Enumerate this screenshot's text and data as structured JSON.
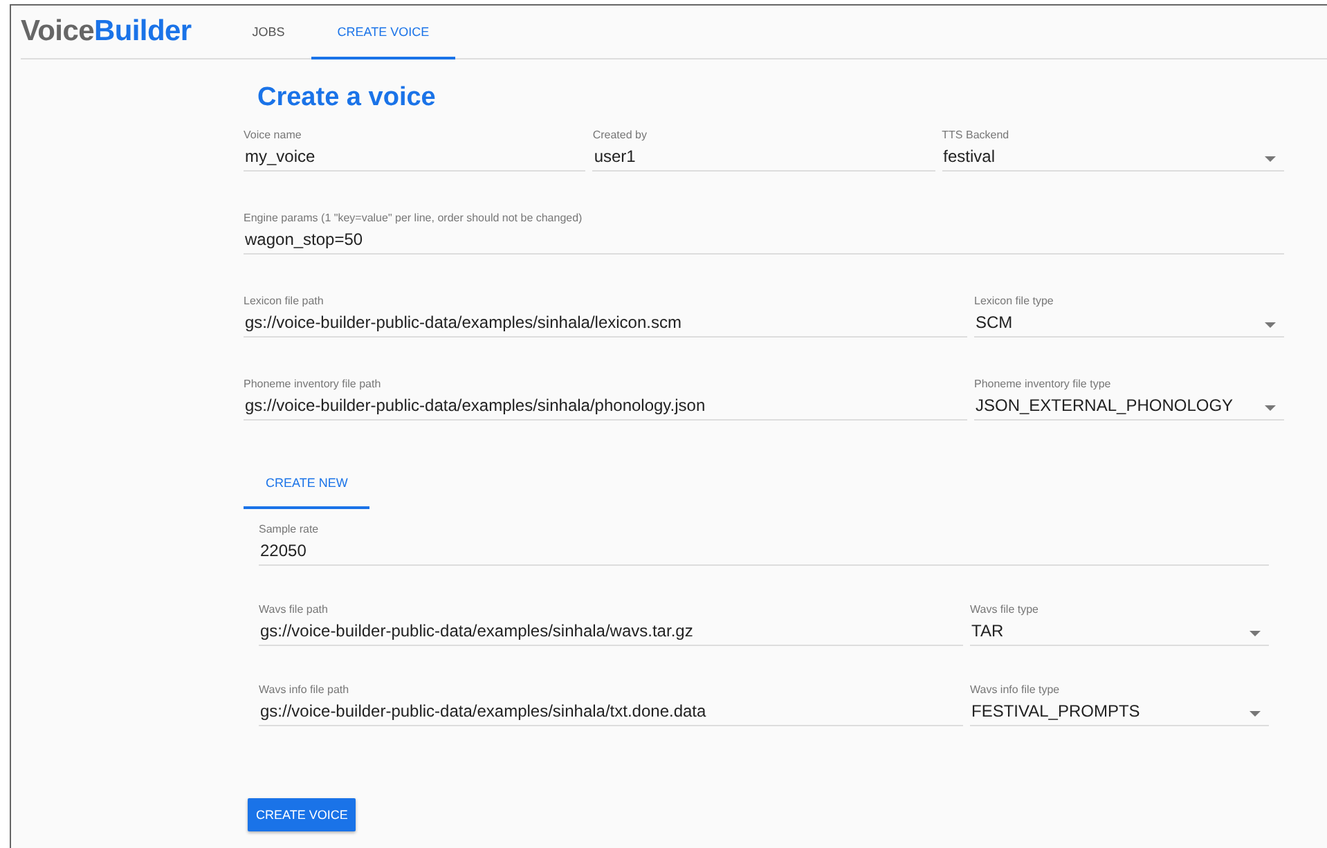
{
  "app": {
    "logo_part1": "Voice",
    "logo_part2": "Builder"
  },
  "nav_tabs": [
    {
      "label": "JOBS",
      "selected": false
    },
    {
      "label": "CREATE VOICE",
      "selected": true
    }
  ],
  "form": {
    "title": "Create a voice",
    "identity": [
      {
        "kind": "text",
        "label": "Voice name",
        "value": "my_voice"
      },
      {
        "kind": "text",
        "label": "Created by",
        "value": "user1"
      },
      {
        "kind": "select",
        "label": "TTS Backend",
        "value": "festival"
      }
    ],
    "engine_params": [
      {
        "label": "Engine params (1 \"key=value\" per line, order should not be changed)",
        "value": "wagon_stop=50"
      }
    ],
    "lexicon": [
      {
        "kind": "text",
        "label": "Lexicon file path",
        "value": "gs://voice-builder-public-data/examples/sinhala/lexicon.scm"
      },
      {
        "kind": "select",
        "label": "Lexicon file type",
        "value": "SCM"
      }
    ],
    "phoneme_inventory": [
      {
        "kind": "text",
        "label": "Phoneme inventory file path",
        "value": "gs://voice-builder-public-data/examples/sinhala/phonology.json"
      },
      {
        "kind": "select",
        "label": "Phoneme inventory file type",
        "value": "JSON_EXTERNAL_PHONOLOGY"
      }
    ],
    "sub_tabs": [
      {
        "label": "CREATE NEW",
        "selected": true
      }
    ],
    "sample_rate": [
      {
        "label": "Sample rate",
        "value": "22050"
      }
    ],
    "wavs": [
      {
        "kind": "text",
        "label": "Wavs file path",
        "value": "gs://voice-builder-public-data/examples/sinhala/wavs.tar.gz"
      },
      {
        "kind": "select",
        "label": "Wavs file type",
        "value": "TAR"
      }
    ],
    "wavs_info": [
      {
        "kind": "text",
        "label": "Wavs info file path",
        "value": "gs://voice-builder-public-data/examples/sinhala/txt.done.data"
      },
      {
        "kind": "select",
        "label": "Wavs info file type",
        "value": "FESTIVAL_PROMPTS"
      }
    ],
    "submit": "CREATE VOICE"
  }
}
